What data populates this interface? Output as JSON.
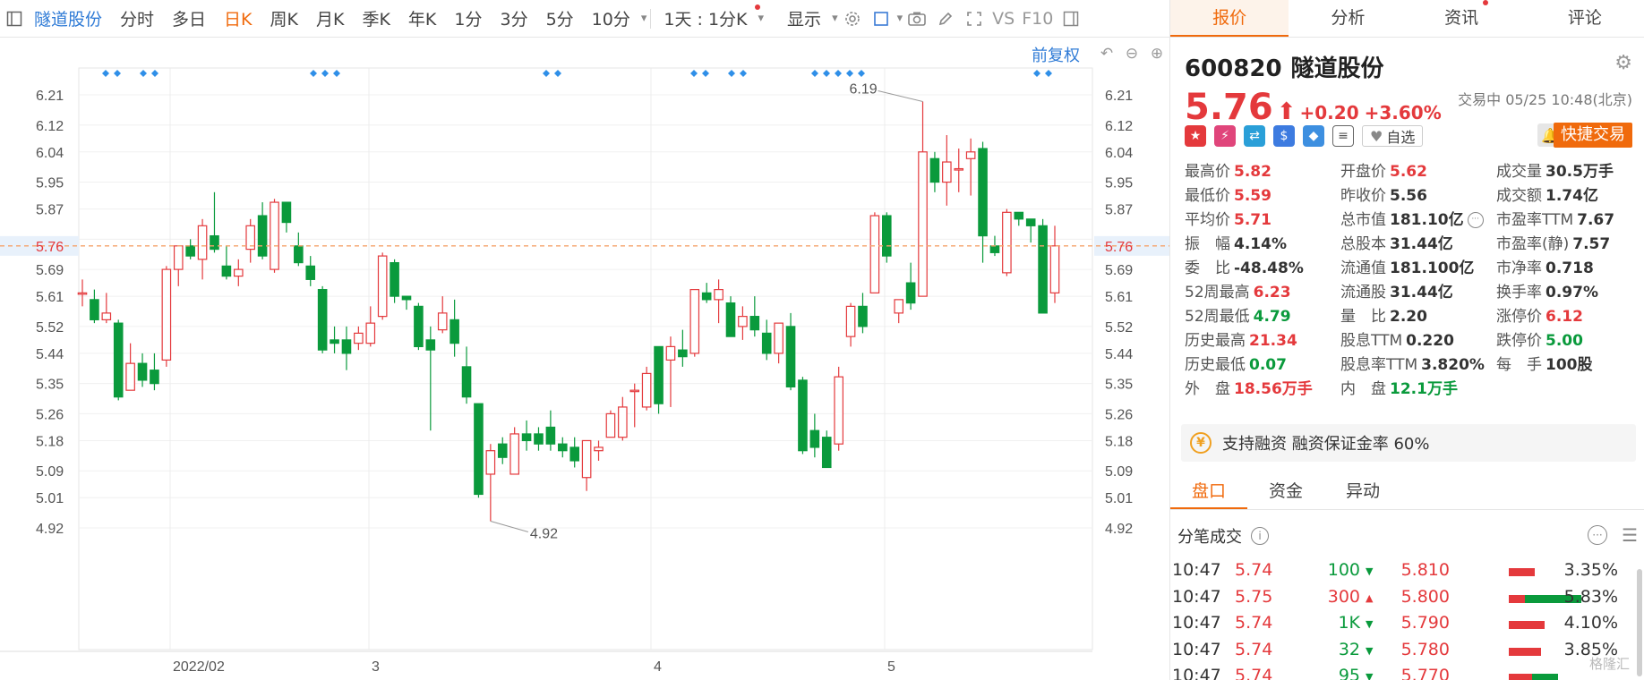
{
  "toolbar": {
    "stock_name": "隧道股份",
    "periods": [
      "分时",
      "多日",
      "日K",
      "周K",
      "月K",
      "季K",
      "年K",
      "1分",
      "3分",
      "5分",
      "10分"
    ],
    "active_period": "日K",
    "interval_selector": "1天 : 1分K",
    "display_label": "显示",
    "vs_label": "VS",
    "f10_label": "F10"
  },
  "chart": {
    "fuquan_label": "前复权",
    "current_price_label": "5.76",
    "max_label": "6.19",
    "min_label": "4.92"
  },
  "chart_data": {
    "type": "candlestick",
    "y_ticks": [
      "6.21",
      "6.12",
      "6.04",
      "5.95",
      "5.87",
      "5.78",
      "5.69",
      "5.61",
      "5.52",
      "5.44",
      "5.35",
      "5.26",
      "5.18",
      "5.09",
      "5.01",
      "4.92"
    ],
    "ylim": [
      4.88,
      6.25
    ],
    "x_labels": [
      "2022/02",
      "3",
      "4",
      "5"
    ],
    "current_price": 5.76,
    "candles": [
      {
        "o": 5.62,
        "h": 5.66,
        "l": 5.58,
        "c": 5.62
      },
      {
        "o": 5.6,
        "h": 5.63,
        "l": 5.53,
        "c": 5.54
      },
      {
        "o": 5.54,
        "h": 5.62,
        "l": 5.53,
        "c": 5.56
      },
      {
        "o": 5.53,
        "h": 5.54,
        "l": 5.3,
        "c": 5.31
      },
      {
        "o": 5.33,
        "h": 5.47,
        "l": 5.33,
        "c": 5.41
      },
      {
        "o": 5.41,
        "h": 5.44,
        "l": 5.34,
        "c": 5.36
      },
      {
        "o": 5.39,
        "h": 5.44,
        "l": 5.33,
        "c": 5.35
      },
      {
        "o": 5.42,
        "h": 5.7,
        "l": 5.4,
        "c": 5.69
      },
      {
        "o": 5.69,
        "h": 5.76,
        "l": 5.64,
        "c": 5.76
      },
      {
        "o": 5.76,
        "h": 5.78,
        "l": 5.72,
        "c": 5.73
      },
      {
        "o": 5.72,
        "h": 5.84,
        "l": 5.66,
        "c": 5.82
      },
      {
        "o": 5.79,
        "h": 5.92,
        "l": 5.74,
        "c": 5.75
      },
      {
        "o": 5.7,
        "h": 5.76,
        "l": 5.66,
        "c": 5.67
      },
      {
        "o": 5.67,
        "h": 5.72,
        "l": 5.64,
        "c": 5.69
      },
      {
        "o": 5.75,
        "h": 5.84,
        "l": 5.71,
        "c": 5.82
      },
      {
        "o": 5.85,
        "h": 5.89,
        "l": 5.72,
        "c": 5.73
      },
      {
        "o": 5.69,
        "h": 5.9,
        "l": 5.68,
        "c": 5.89
      },
      {
        "o": 5.89,
        "h": 5.89,
        "l": 5.8,
        "c": 5.83
      },
      {
        "o": 5.76,
        "h": 5.8,
        "l": 5.7,
        "c": 5.71
      },
      {
        "o": 5.7,
        "h": 5.73,
        "l": 5.64,
        "c": 5.66
      },
      {
        "o": 5.63,
        "h": 5.64,
        "l": 5.44,
        "c": 5.45
      },
      {
        "o": 5.48,
        "h": 5.52,
        "l": 5.44,
        "c": 5.47
      },
      {
        "o": 5.48,
        "h": 5.52,
        "l": 5.39,
        "c": 5.44
      },
      {
        "o": 5.47,
        "h": 5.52,
        "l": 5.45,
        "c": 5.5
      },
      {
        "o": 5.47,
        "h": 5.58,
        "l": 5.46,
        "c": 5.53
      },
      {
        "o": 5.55,
        "h": 5.74,
        "l": 5.54,
        "c": 5.73
      },
      {
        "o": 5.71,
        "h": 5.72,
        "l": 5.59,
        "c": 5.61
      },
      {
        "o": 5.61,
        "h": 5.61,
        "l": 5.57,
        "c": 5.6
      },
      {
        "o": 5.58,
        "h": 5.59,
        "l": 5.45,
        "c": 5.46
      },
      {
        "o": 5.48,
        "h": 5.52,
        "l": 5.21,
        "c": 5.45
      },
      {
        "o": 5.51,
        "h": 5.61,
        "l": 5.5,
        "c": 5.56
      },
      {
        "o": 5.54,
        "h": 5.6,
        "l": 5.43,
        "c": 5.47
      },
      {
        "o": 5.4,
        "h": 5.46,
        "l": 5.29,
        "c": 5.31
      },
      {
        "o": 5.29,
        "h": 5.29,
        "l": 5.01,
        "c": 5.02
      },
      {
        "o": 5.08,
        "h": 5.17,
        "l": 4.94,
        "c": 5.15
      },
      {
        "o": 5.17,
        "h": 5.19,
        "l": 5.11,
        "c": 5.13
      },
      {
        "o": 5.08,
        "h": 5.22,
        "l": 5.08,
        "c": 5.2
      },
      {
        "o": 5.2,
        "h": 5.24,
        "l": 5.15,
        "c": 5.18
      },
      {
        "o": 5.2,
        "h": 5.22,
        "l": 5.15,
        "c": 5.17
      },
      {
        "o": 5.22,
        "h": 5.27,
        "l": 5.15,
        "c": 5.17
      },
      {
        "o": 5.17,
        "h": 5.19,
        "l": 5.13,
        "c": 5.15
      },
      {
        "o": 5.16,
        "h": 5.19,
        "l": 5.1,
        "c": 5.12
      },
      {
        "o": 5.07,
        "h": 5.18,
        "l": 5.03,
        "c": 5.18
      },
      {
        "o": 5.15,
        "h": 5.18,
        "l": 5.12,
        "c": 5.16
      },
      {
        "o": 5.19,
        "h": 5.27,
        "l": 5.19,
        "c": 5.26
      },
      {
        "o": 5.19,
        "h": 5.31,
        "l": 5.18,
        "c": 5.28
      },
      {
        "o": 5.33,
        "h": 5.35,
        "l": 5.22,
        "c": 5.33
      },
      {
        "o": 5.28,
        "h": 5.4,
        "l": 5.27,
        "c": 5.38
      },
      {
        "o": 5.46,
        "h": 5.46,
        "l": 5.26,
        "c": 5.29
      },
      {
        "o": 5.42,
        "h": 5.49,
        "l": 5.28,
        "c": 5.46
      },
      {
        "o": 5.45,
        "h": 5.51,
        "l": 5.4,
        "c": 5.43
      },
      {
        "o": 5.44,
        "h": 5.59,
        "l": 5.43,
        "c": 5.63
      },
      {
        "o": 5.62,
        "h": 5.65,
        "l": 5.59,
        "c": 5.6
      },
      {
        "o": 5.6,
        "h": 5.66,
        "l": 5.53,
        "c": 5.63
      },
      {
        "o": 5.59,
        "h": 5.61,
        "l": 5.49,
        "c": 5.49
      },
      {
        "o": 5.52,
        "h": 5.58,
        "l": 5.48,
        "c": 5.55
      },
      {
        "o": 5.55,
        "h": 5.61,
        "l": 5.49,
        "c": 5.51
      },
      {
        "o": 5.5,
        "h": 5.54,
        "l": 5.42,
        "c": 5.44
      },
      {
        "o": 5.44,
        "h": 5.51,
        "l": 5.41,
        "c": 5.53
      },
      {
        "o": 5.52,
        "h": 5.56,
        "l": 5.33,
        "c": 5.34
      },
      {
        "o": 5.36,
        "h": 5.37,
        "l": 5.14,
        "c": 5.15
      },
      {
        "o": 5.21,
        "h": 5.26,
        "l": 5.13,
        "c": 5.16
      },
      {
        "o": 5.19,
        "h": 5.21,
        "l": 5.1,
        "c": 5.1
      },
      {
        "o": 5.17,
        "h": 5.4,
        "l": 5.15,
        "c": 5.37
      },
      {
        "o": 5.49,
        "h": 5.59,
        "l": 5.46,
        "c": 5.58
      },
      {
        "o": 5.58,
        "h": 5.62,
        "l": 5.5,
        "c": 5.52
      },
      {
        "o": 5.62,
        "h": 5.86,
        "l": 5.62,
        "c": 5.85
      },
      {
        "o": 5.85,
        "h": 5.86,
        "l": 5.71,
        "c": 5.73
      },
      {
        "o": 5.56,
        "h": 5.6,
        "l": 5.53,
        "c": 5.6
      },
      {
        "o": 5.65,
        "h": 5.71,
        "l": 5.57,
        "c": 5.59
      },
      {
        "o": 5.61,
        "h": 6.19,
        "l": 5.61,
        "c": 6.04
      },
      {
        "o": 6.02,
        "h": 6.04,
        "l": 5.92,
        "c": 5.95
      },
      {
        "o": 5.95,
        "h": 6.09,
        "l": 5.88,
        "c": 6.01
      },
      {
        "o": 5.99,
        "h": 6.05,
        "l": 5.92,
        "c": 5.99
      },
      {
        "o": 6.02,
        "h": 6.08,
        "l": 5.91,
        "c": 6.04
      },
      {
        "o": 6.05,
        "h": 6.07,
        "l": 5.71,
        "c": 5.79
      },
      {
        "o": 5.76,
        "h": 5.79,
        "l": 5.73,
        "c": 5.74
      },
      {
        "o": 5.68,
        "h": 5.87,
        "l": 5.67,
        "c": 5.86
      },
      {
        "o": 5.86,
        "h": 5.86,
        "l": 5.82,
        "c": 5.84
      },
      {
        "o": 5.84,
        "h": 5.84,
        "l": 5.77,
        "c": 5.82
      },
      {
        "o": 5.82,
        "h": 5.84,
        "l": 5.57,
        "c": 5.56
      },
      {
        "o": 5.62,
        "h": 5.82,
        "l": 5.59,
        "c": 5.76
      }
    ]
  },
  "quote_tabs": [
    "报价",
    "分析",
    "资讯",
    "评论"
  ],
  "stock": {
    "code": "600820",
    "name": "隧道股份",
    "price": "5.76",
    "arrow": "⬆",
    "change": "+0.20",
    "change_pct": "+3.60%",
    "status": "交易中 05/25 10:48(北京)"
  },
  "actions": {
    "zixuan_label": "自选",
    "fast_trade_label": "快捷交易"
  },
  "stats": [
    {
      "k": "最高价",
      "v": "5.82",
      "c": "red"
    },
    {
      "k": "开盘价",
      "v": "5.62",
      "c": "red"
    },
    {
      "k": "成交量",
      "v": "30.5万手",
      "c": ""
    },
    {
      "k": "最低价",
      "v": "5.59",
      "c": "red"
    },
    {
      "k": "昨收价",
      "v": "5.56",
      "c": ""
    },
    {
      "k": "成交额",
      "v": "1.74亿",
      "c": ""
    },
    {
      "k": "平均价",
      "v": "5.71",
      "c": "red"
    },
    {
      "k": "总市值",
      "v": "181.10亿",
      "c": ""
    },
    {
      "k": "市盈率TTM",
      "v": "7.67",
      "c": ""
    },
    {
      "k": "振　幅",
      "v": "4.14%",
      "c": ""
    },
    {
      "k": "总股本",
      "v": "31.44亿",
      "c": ""
    },
    {
      "k": "市盈率(静)",
      "v": "7.57",
      "c": ""
    },
    {
      "k": "委　比",
      "v": "-48.48%",
      "c": ""
    },
    {
      "k": "流通值",
      "v": "181.100亿",
      "c": ""
    },
    {
      "k": "市净率",
      "v": "0.718",
      "c": ""
    },
    {
      "k": "52周最高",
      "v": "6.23",
      "c": "red"
    },
    {
      "k": "流通股",
      "v": "31.44亿",
      "c": ""
    },
    {
      "k": "换手率",
      "v": "0.97%",
      "c": ""
    },
    {
      "k": "52周最低",
      "v": "4.79",
      "c": "green"
    },
    {
      "k": "量　比",
      "v": "2.20",
      "c": ""
    },
    {
      "k": "涨停价",
      "v": "6.12",
      "c": "red"
    },
    {
      "k": "历史最高",
      "v": "21.34",
      "c": "red"
    },
    {
      "k": "股息TTM",
      "v": "0.220",
      "c": ""
    },
    {
      "k": "跌停价",
      "v": "5.00",
      "c": "green"
    },
    {
      "k": "历史最低",
      "v": "0.07",
      "c": "green"
    },
    {
      "k": "股息率TTM",
      "v": "3.820%",
      "c": ""
    },
    {
      "k": "每　手",
      "v": "100股",
      "c": ""
    },
    {
      "k": "外　盘",
      "v": "18.56万手",
      "c": "red"
    },
    {
      "k": "内　盘",
      "v": "12.1万手",
      "c": "green"
    },
    {
      "k": "",
      "v": "",
      "c": ""
    }
  ],
  "margin_info": "支持融资 融资保证金率 60%",
  "sub_tabs": [
    "盘口",
    "资金",
    "异动"
  ],
  "ticks": {
    "title": "分笔成交",
    "rows": [
      {
        "time": "10:47",
        "price": "5.74",
        "vol": "100",
        "dir": "down",
        "level": "5.810",
        "pct": "3.35%",
        "red_frac": 0.55,
        "green_frac": 0.0
      },
      {
        "time": "10:47",
        "price": "5.75",
        "vol": "300",
        "dir": "up",
        "level": "5.800",
        "pct": "5.83%",
        "red_frac": 0.35,
        "green_frac": 0.65
      },
      {
        "time": "10:47",
        "price": "5.74",
        "vol": "1K",
        "dir": "down",
        "level": "5.790",
        "pct": "4.10%",
        "red_frac": 0.75,
        "green_frac": 0.0
      },
      {
        "time": "10:47",
        "price": "5.74",
        "vol": "32",
        "dir": "down",
        "level": "5.780",
        "pct": "3.85%",
        "red_frac": 0.68,
        "green_frac": 0.0
      },
      {
        "time": "10:47",
        "price": "5.74",
        "vol": "95",
        "dir": "down",
        "level": "5.770",
        "pct": "",
        "red_frac": 0.5,
        "green_frac": 0.3
      }
    ]
  },
  "colors": {
    "up": "#e4393c",
    "down": "#0a9a3c",
    "accent": "#f06a0c",
    "link": "#2f7bd6",
    "current_line": "#f5a26b",
    "marker": "#2f8fe8"
  },
  "watermark": "格隆汇"
}
